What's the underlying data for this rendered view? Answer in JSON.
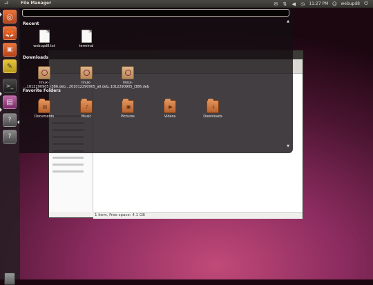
{
  "panel": {
    "title": "File Manager",
    "clock": "11:27 PM",
    "user": "webupd8",
    "icons": [
      "mail-icon",
      "network-icon",
      "volume-icon",
      "clock-icon",
      "user-icon",
      "power-icon"
    ]
  },
  "launcher": {
    "items": [
      "ubuntu-home-icon",
      "firefox-icon",
      "shotwell-icon",
      "notes-icon",
      "terminal-icon",
      "file-manager-icon",
      "workspaces-icon",
      "applications-icon"
    ],
    "trash": "trash-icon"
  },
  "dash": {
    "search_value": "",
    "recent_label": "Recent",
    "recent": [
      {
        "name": "webupd8.txt",
        "icon": "text-file-icon"
      },
      {
        "name": "terminal",
        "icon": "text-file-icon"
      }
    ],
    "downloads_label": "Downloads",
    "downloads": [
      {
        "line1": "linux-",
        "line2": "...1012290905_i386.deb",
        "icon": "deb-package-icon"
      },
      {
        "line1": "linux-",
        "line2": "...201012290905_all.deb",
        "icon": "deb-package-icon"
      },
      {
        "line1": "linux-",
        "line2": "...1012290905_i386.deb",
        "icon": "deb-package-icon"
      }
    ],
    "favorites_label": "Favorite Folders",
    "favorites": [
      {
        "name": "Documents",
        "icon": "documents-folder-icon"
      },
      {
        "name": "Music",
        "icon": "music-folder-icon"
      },
      {
        "name": "Pictures",
        "icon": "pictures-folder-icon"
      },
      {
        "name": "Videos",
        "icon": "videos-folder-icon"
      },
      {
        "name": "Downloads",
        "icon": "downloads-folder-icon"
      }
    ]
  },
  "file_manager": {
    "status": "1 item, Free space: 4.1 GB"
  },
  "colors": {
    "panel": "#3c3b37",
    "accent": "#dd4814",
    "wallpaper": "#8c2c60"
  }
}
